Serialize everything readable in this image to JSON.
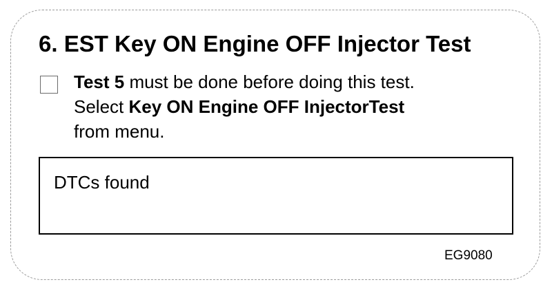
{
  "title": "6. EST Key ON Engine OFF Injector Test",
  "instructions": {
    "line1_bold": "Test 5",
    "line1_rest": " must be done before doing this test.",
    "line2_prefix": "Select ",
    "line2_bold": "Key ON Engine OFF InjectorTest",
    "line3": "from menu."
  },
  "checkbox": {
    "checked": false
  },
  "dtc_box": {
    "label": "DTCs found"
  },
  "figure_id": "EG9080"
}
